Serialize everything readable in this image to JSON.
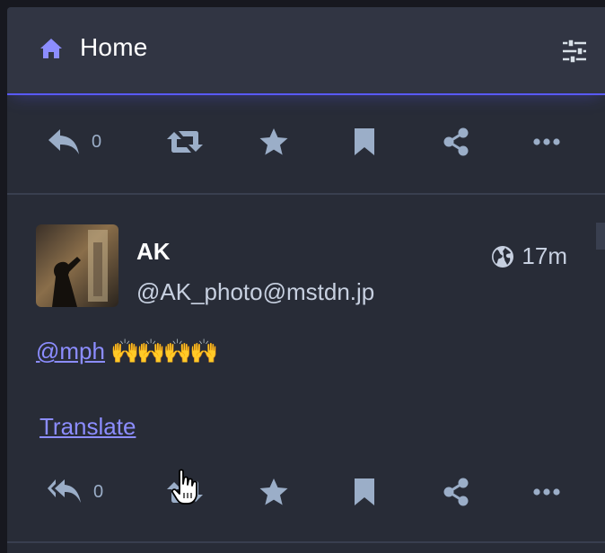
{
  "header": {
    "title": "Home",
    "icon": "home-icon",
    "settings_icon": "sliders-icon"
  },
  "top_actions": {
    "reply_count": "0"
  },
  "status": {
    "display_name": "AK",
    "acct": "@AK_photo@mstdn.jp",
    "visibility_icon": "globe-icon",
    "time": "17m",
    "mention": "@mph",
    "emoji": "🙌🙌🙌🙌",
    "translate": "Translate",
    "reply_count": "0"
  },
  "colors": {
    "accent": "#8c8dff",
    "header_bg": "#313543",
    "column_bg": "#282c37",
    "icon": "#9baec8"
  }
}
